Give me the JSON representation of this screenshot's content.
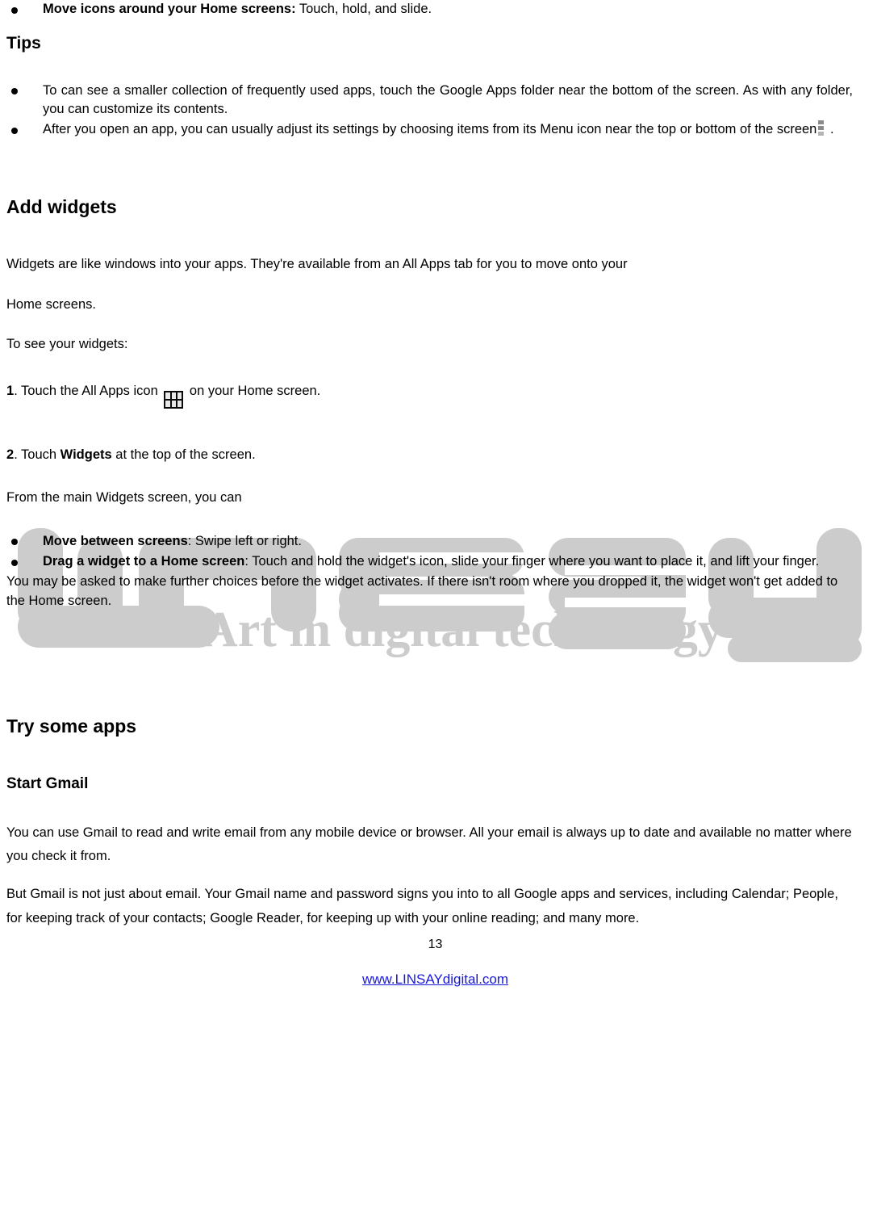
{
  "document": {
    "page_number": "13",
    "footer_link": "www.LINSAYdigital.com",
    "footer_link_color": "#1818d8"
  },
  "watermark": {
    "logo_text": "LINSAY",
    "tagline": "Art in digital technology",
    "color": "#cccccc"
  },
  "intro_bullet": {
    "label": "Move icons around your Home screens:",
    "text": " Touch, hold, and slide."
  },
  "tips": {
    "heading": "Tips",
    "items": [
      "To can see a smaller collection of frequently used apps, touch the Google Apps folder near the bottom of the screen. As with any folder, you can customize its contents.",
      {
        "before": "After you open an app, you can usually adjust its settings by choosing items from its Menu icon near the top or bottom of the screen",
        "icon": "menu-dots-icon",
        "after": " ."
      }
    ]
  },
  "add_widgets": {
    "heading": "Add widgets",
    "paragraphs": [
      "Widgets are like windows into your apps. They're available from an All Apps tab for you to move onto your",
      "Home screens.",
      "To see your widgets:"
    ],
    "steps": [
      {
        "number": "1",
        "before": ". Touch the All Apps icon ",
        "icon": "all-apps-grid-icon",
        "after": " on your Home screen."
      },
      {
        "number": "2",
        "before": ". Touch ",
        "bold": "Widgets",
        "after": " at the top of the screen."
      }
    ],
    "lead_in": "From the main Widgets screen, you can",
    "bullets": [
      {
        "label": "Move between screens",
        "text": ": Swipe left or right."
      },
      {
        "label": "Drag a widget to a Home screen",
        "text": ": Touch and hold the widget's icon, slide your finger where you want to place it, and lift your finger."
      }
    ],
    "closing": "You may be asked to make further choices before the widget activates. If there isn't room where you dropped it, the widget won't get added to the Home screen."
  },
  "try_some_apps": {
    "heading": "Try some apps",
    "start_gmail": {
      "heading": "Start Gmail",
      "paragraphs": [
        "You can use Gmail to read and write email from any mobile device or browser. All your email is always up to date and available no matter where you check it from.",
        "But Gmail is not just about email. Your Gmail name and password signs you into to all Google apps and services, including Calendar; People, for keeping track of your contacts; Google Reader, for keeping up with your online reading; and many more."
      ]
    }
  }
}
